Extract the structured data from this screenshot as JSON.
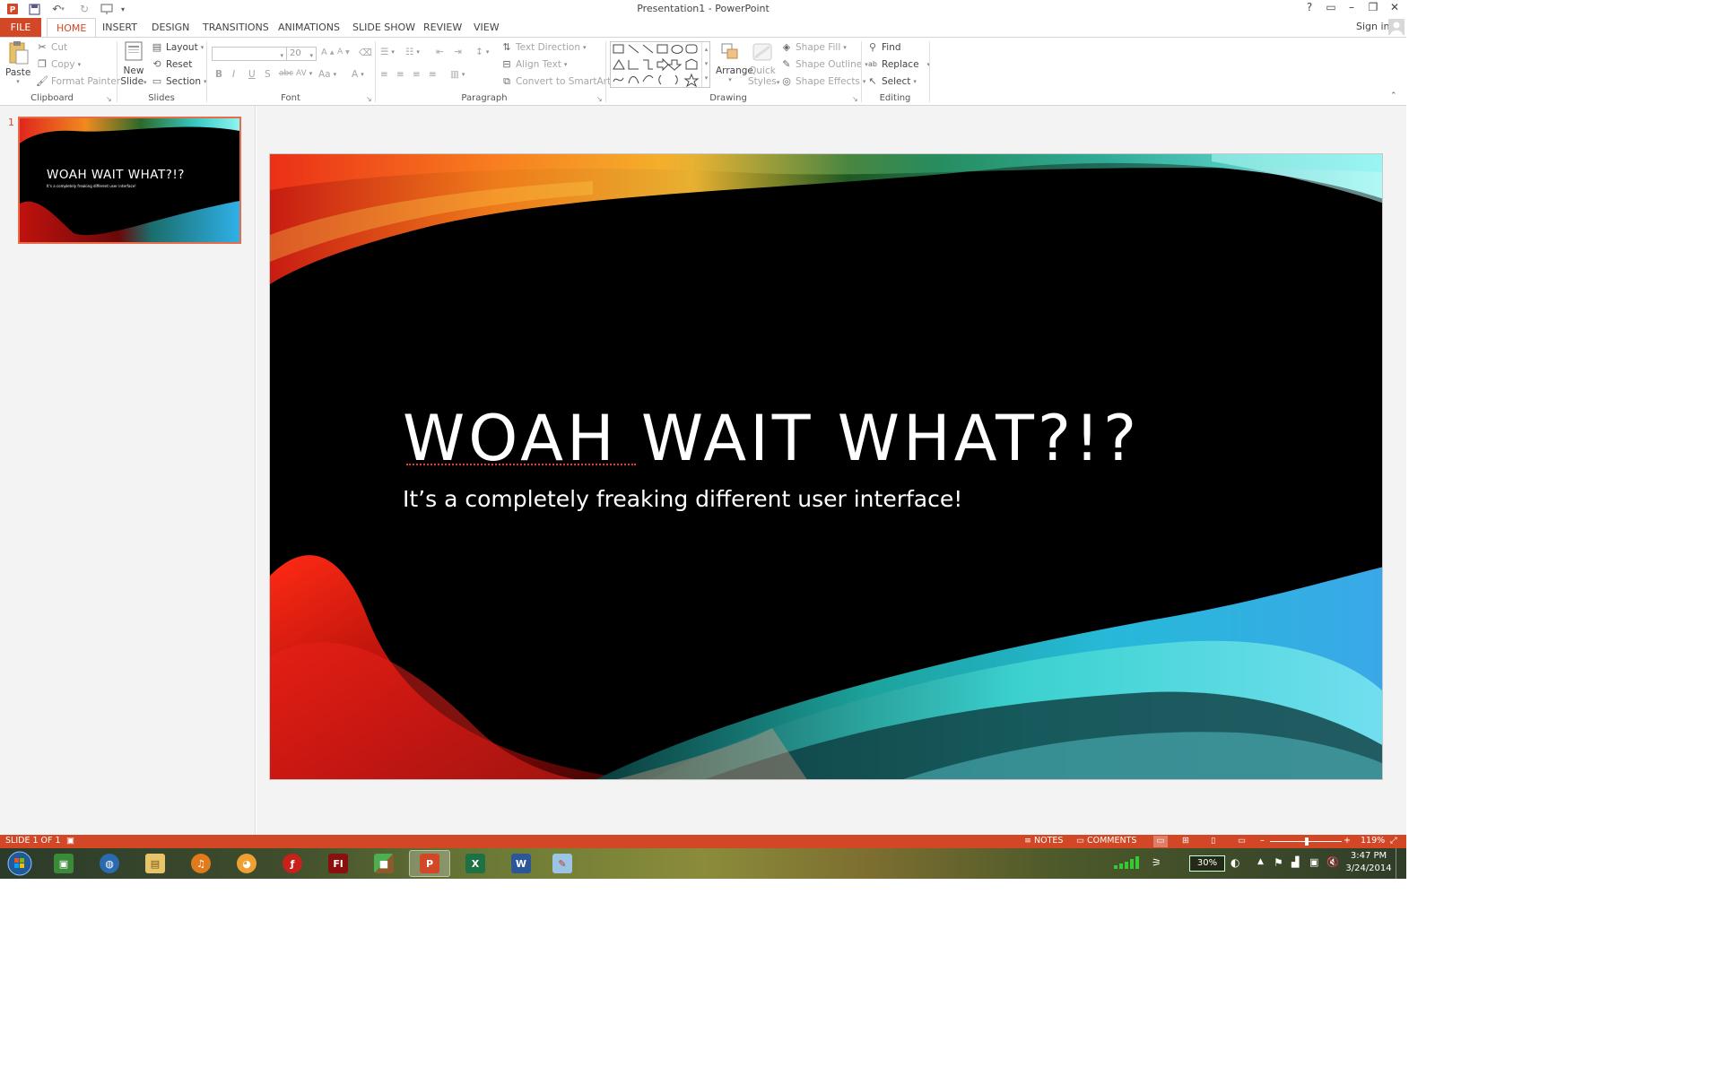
{
  "window": {
    "title": "Presentation1 - PowerPoint"
  },
  "account": {
    "sign_in": "Sign in"
  },
  "tabs": [
    "FILE",
    "HOME",
    "INSERT",
    "DESIGN",
    "TRANSITIONS",
    "ANIMATIONS",
    "SLIDE SHOW",
    "REVIEW",
    "VIEW"
  ],
  "ribbon": {
    "clipboard": {
      "label": "Clipboard",
      "paste": "Paste",
      "cut": "Cut",
      "copy": "Copy",
      "format_painter": "Format Painter"
    },
    "slides": {
      "label": "Slides",
      "new_slide_1": "New",
      "new_slide_2": "Slide",
      "layout": "Layout",
      "reset": "Reset",
      "section": "Section"
    },
    "font": {
      "label": "Font",
      "font_size": "20",
      "bold": "B",
      "italic": "I",
      "underline": "U",
      "shadow": "S",
      "strike": "abc",
      "spacing": "AV",
      "case": "Aa",
      "color": "A"
    },
    "paragraph": {
      "label": "Paragraph",
      "text_direction": "Text Direction",
      "align_text": "Align Text",
      "convert_smartart": "Convert to SmartArt"
    },
    "drawing": {
      "label": "Drawing",
      "arrange": "Arrange",
      "quick_styles_1": "Quick",
      "quick_styles_2": "Styles",
      "shape_fill": "Shape Fill",
      "shape_outline": "Shape Outline",
      "shape_effects": "Shape Effects"
    },
    "editing": {
      "label": "Editing",
      "find": "Find",
      "replace": "Replace",
      "select": "Select"
    }
  },
  "thumbnail": {
    "number": "1",
    "title": "WOAH WAIT WHAT?!?",
    "subtitle": "It's a completely freaking different user interface!"
  },
  "slide": {
    "title": "WOAH WAIT WHAT?!?",
    "subtitle": "It’s a completely freaking different user interface!"
  },
  "status": {
    "slide": "SLIDE 1 OF 1",
    "notes": "NOTES",
    "comments": "COMMENTS",
    "zoom": "119%"
  },
  "taskbar": {
    "apps": [
      "windows-explorer",
      "internet",
      "file-explorer",
      "media",
      "scratch",
      "flash",
      "flash-pro",
      "minecraft",
      "powerpoint",
      "excel",
      "word",
      "paint"
    ],
    "battery": "30%",
    "time": "3:47 PM",
    "date": "3/24/2014"
  },
  "colors": {
    "accent": "#d24726",
    "status_bar": "#d24726",
    "thumb_border": "#e86c4a"
  }
}
